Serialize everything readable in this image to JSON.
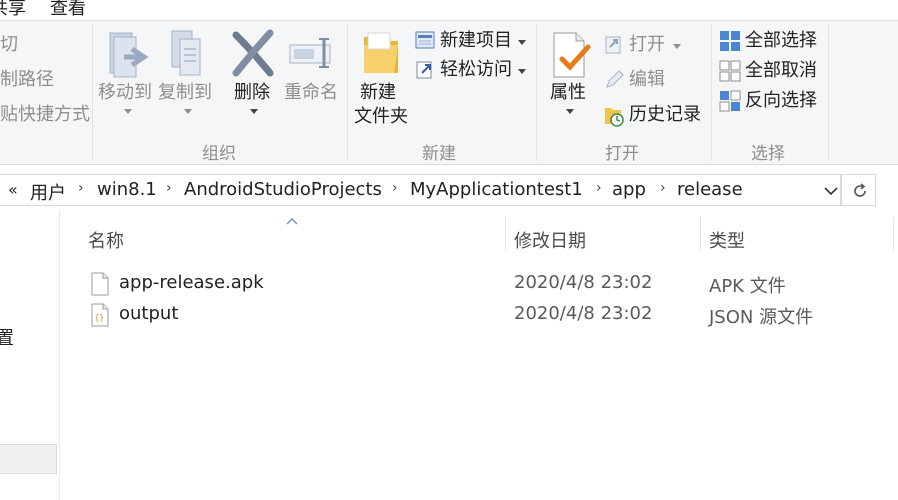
{
  "tabs": {
    "share": "共享",
    "view": "查看"
  },
  "ribbon": {
    "clipboard": {
      "cut": "剪切",
      "copy_path": "复制路径",
      "paste_shortcut": "粘贴快捷方式"
    },
    "organize": {
      "move_to": "移动到",
      "copy_to": "复制到",
      "delete": "删除",
      "rename": "重命名",
      "group": "组织"
    },
    "new": {
      "new_folder_1": "新建",
      "new_folder_2": "文件夹",
      "new_item": "新建项目",
      "easy_access": "轻松访问",
      "group": "新建"
    },
    "open": {
      "properties": "属性",
      "open": "打开",
      "edit": "编辑",
      "history": "历史记录",
      "group": "打开"
    },
    "select": {
      "select_all": "全部选择",
      "select_none": "全部取消",
      "invert": "反向选择",
      "group": "选择"
    }
  },
  "address": {
    "overflow": "«",
    "crumbs": [
      "用户",
      "win8.1",
      "AndroidStudioProjects",
      "MyApplicationtest1",
      "app",
      "release"
    ]
  },
  "nav": {
    "partial_item": "置"
  },
  "list": {
    "columns": {
      "name": "名称",
      "date": "修改日期",
      "type": "类型"
    },
    "files": [
      {
        "name": "app-release.apk",
        "date": "2020/4/8 23:02",
        "type": "APK 文件"
      },
      {
        "name": "output",
        "date": "2020/4/8 23:02",
        "type": "JSON 源文件"
      }
    ]
  },
  "colors": {
    "accent": "#1e6fd9",
    "folder": "#f2c24b",
    "disabled": "#8e8e8e",
    "ribbon_bg": "#f5f6f7"
  }
}
